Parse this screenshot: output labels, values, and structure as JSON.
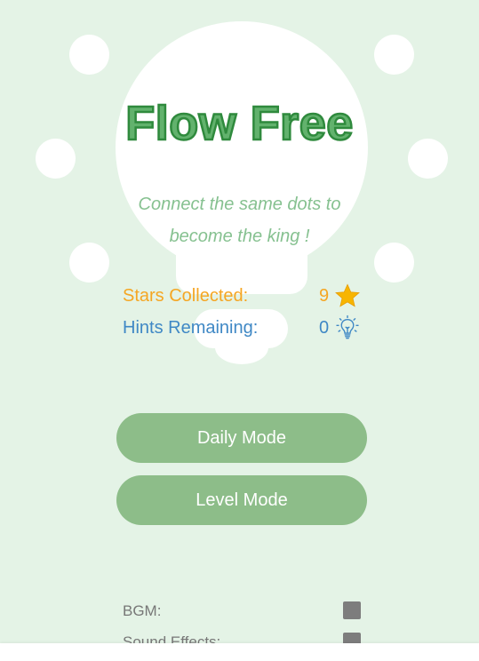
{
  "app": {
    "title": "Flow Free",
    "subtitle": "Connect the same dots to become the king !"
  },
  "stats": {
    "stars_label": "Stars Collected:",
    "stars_value": "9",
    "hints_label": "Hints Remaining:",
    "hints_value": "0"
  },
  "modes": {
    "daily": "Daily Mode",
    "level": "Level Mode"
  },
  "settings": {
    "bgm_label": "BGM:",
    "sfx_label": "Sound Effects:"
  },
  "colors": {
    "background": "#e4f3e6",
    "title_fill": "#62b26d",
    "stars": "#f5a623",
    "hints": "#3f88c5",
    "button": "#8dbd89"
  },
  "icons": {
    "stars": "star-icon",
    "hints": "lightbulb-icon"
  }
}
